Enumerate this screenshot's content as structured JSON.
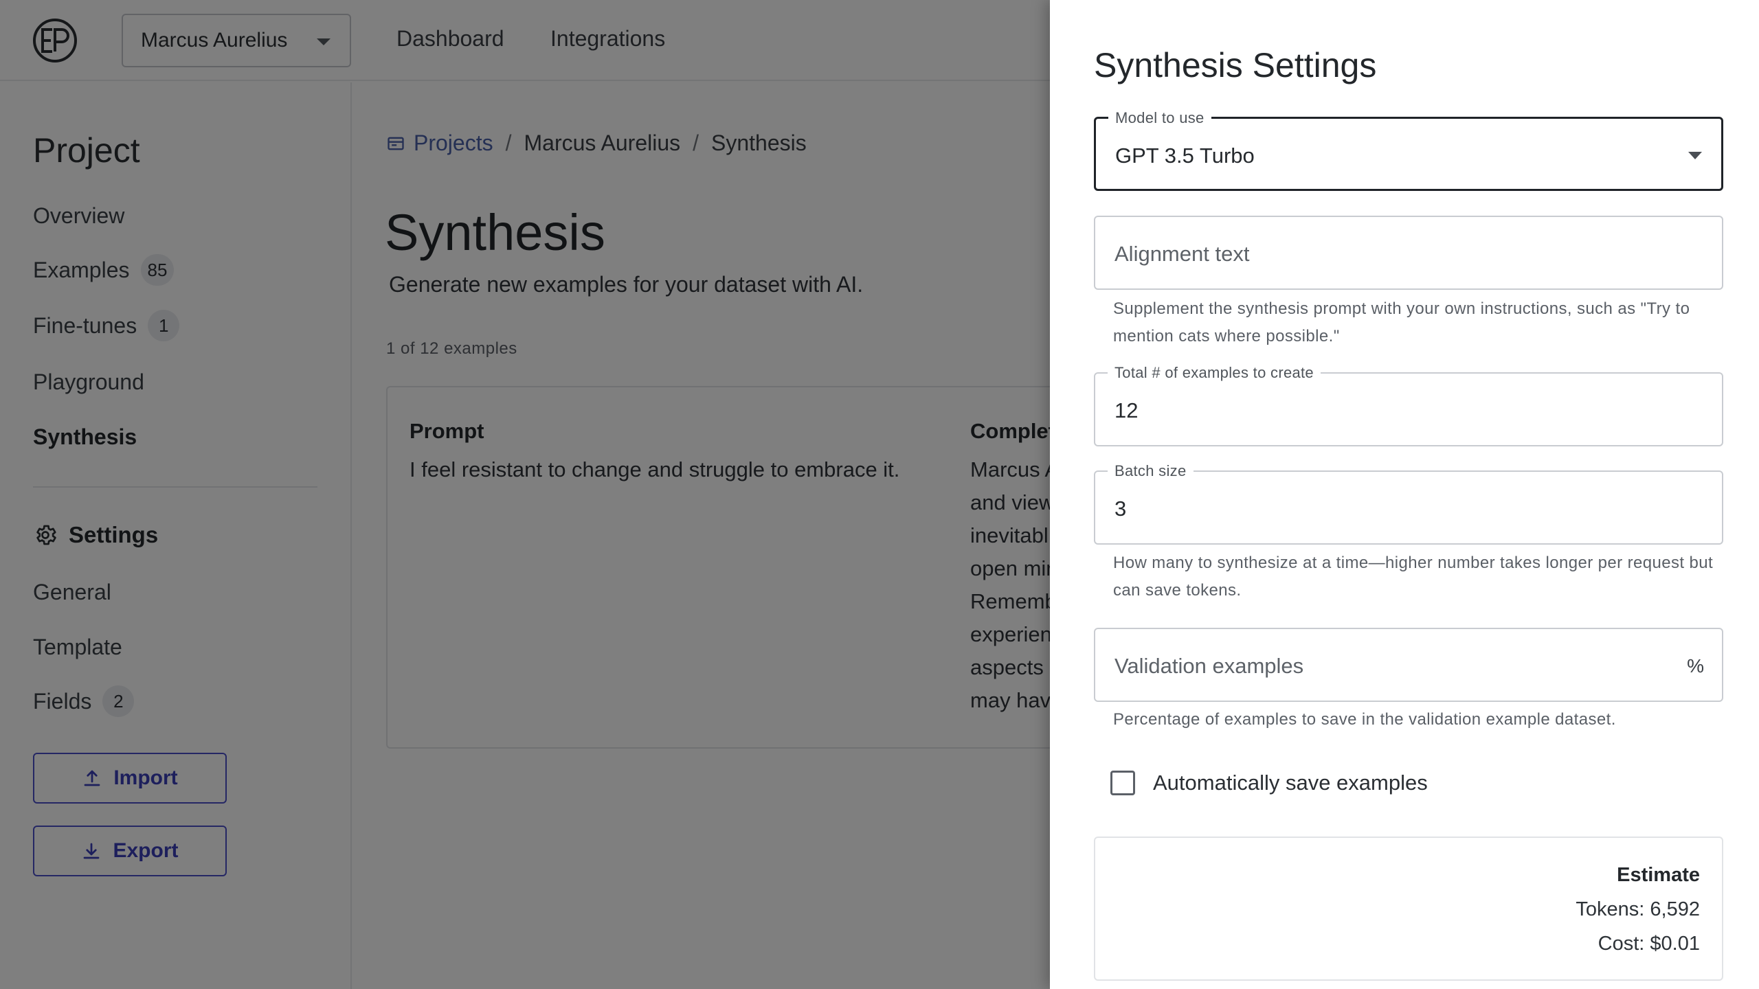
{
  "header": {
    "project_selector": "Marcus Aurelius",
    "nav": [
      "Dashboard",
      "Integrations"
    ]
  },
  "sidebar": {
    "heading": "Project",
    "items": [
      {
        "label": "Overview",
        "badge": null
      },
      {
        "label": "Examples",
        "badge": "85"
      },
      {
        "label": "Fine-tunes",
        "badge": "1"
      },
      {
        "label": "Playground",
        "badge": null
      },
      {
        "label": "Synthesis",
        "badge": null,
        "active": true
      }
    ],
    "settings_heading": "Settings",
    "settings_items": [
      {
        "label": "General",
        "badge": null
      },
      {
        "label": "Template",
        "badge": null
      },
      {
        "label": "Fields",
        "badge": "2"
      }
    ],
    "import_label": "Import",
    "export_label": "Export"
  },
  "main": {
    "breadcrumb": [
      "Projects",
      "Marcus Aurelius",
      "Synthesis"
    ],
    "title": "Synthesis",
    "subtitle": "Generate new examples for your dataset with AI.",
    "count": "1 of 12 examples",
    "example": {
      "prompt_label": "Prompt",
      "prompt_text": "I feel resistant to change and struggle to embrace it.",
      "completion_label": "Complet",
      "completion_lines": [
        "Marcus A",
        "and view",
        "inevitabl",
        "open min",
        "Rememb",
        "experien",
        "aspects",
        "may hav"
      ]
    }
  },
  "drawer": {
    "title": "Synthesis Settings",
    "model": {
      "label": "Model to use",
      "value": "GPT 3.5 Turbo"
    },
    "alignment": {
      "placeholder": "Alignment text",
      "helper": "Supplement the synthesis prompt with your own instructions, such as \"Try to mention cats where possible.\""
    },
    "total": {
      "label": "Total # of examples to create",
      "value": "12"
    },
    "batch": {
      "label": "Batch size",
      "value": "3",
      "helper": "How many to synthesize at a time—higher number takes longer per request but can save tokens."
    },
    "validation": {
      "placeholder": "Validation examples",
      "suffix": "%",
      "helper": "Percentage of examples to save in the validation example dataset."
    },
    "autosave": {
      "label": "Automatically save examples",
      "checked": false
    },
    "estimate": {
      "title": "Estimate",
      "tokens": "Tokens: 6,592",
      "cost": "Cost: $0.01"
    }
  }
}
